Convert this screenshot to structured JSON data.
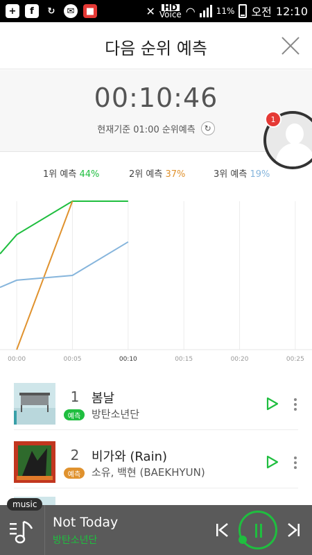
{
  "status_bar": {
    "battery_text": "11%",
    "ampm": "오전",
    "time": "12:10",
    "voice_label": "Voice",
    "hd_label": "HD"
  },
  "header": {
    "title": "다음 순위 예측"
  },
  "timer": {
    "value": "00:10:46",
    "basis_text": "현재기준 01:00 순위예측"
  },
  "badge_count": "1",
  "legend": [
    {
      "label": "1위 예측",
      "percent": "44%"
    },
    {
      "label": "2위 예측",
      "percent": "37%"
    },
    {
      "label": "3위 예측",
      "percent": "19%"
    }
  ],
  "chart_data": {
    "type": "line",
    "x": [
      "00:00",
      "00:05",
      "00:10",
      "00:15",
      "00:20",
      "00:25"
    ],
    "x_tick_labels": [
      "00:00",
      "00:05",
      "00:10",
      "00:15",
      "00:20",
      "00:25"
    ],
    "highlight_tick": "00:10",
    "series": [
      {
        "name": "1위 예측",
        "color": "#1fbe3f",
        "values": [
          [
            -1.5,
            40
          ],
          [
            0,
            48
          ],
          [
            5,
            62
          ],
          [
            10,
            62
          ]
        ]
      },
      {
        "name": "2위 예측",
        "color": "#e0922e",
        "values": [
          [
            0,
            0
          ],
          [
            5,
            62
          ]
        ]
      },
      {
        "name": "3위 예측",
        "color": "#86b5dc",
        "values": [
          [
            -1.5,
            26
          ],
          [
            0,
            29
          ],
          [
            5,
            31
          ],
          [
            10,
            45
          ]
        ]
      }
    ],
    "xlim": [
      -1.5,
      26.5
    ],
    "ylim": [
      0,
      62
    ],
    "grid": true
  },
  "list": [
    {
      "rank": "1",
      "tag": "예측",
      "tag_color": "#1fbe3f",
      "title": "봄날",
      "artist": "방탄소년단"
    },
    {
      "rank": "2",
      "tag": "예측",
      "tag_color": "#e0922e",
      "title": "비가와 (Rain)",
      "artist": "소유, 백현 (BAEKHYUN)"
    }
  ],
  "player": {
    "tag": "music",
    "title": "Not Today",
    "artist": "방탄소년단"
  }
}
